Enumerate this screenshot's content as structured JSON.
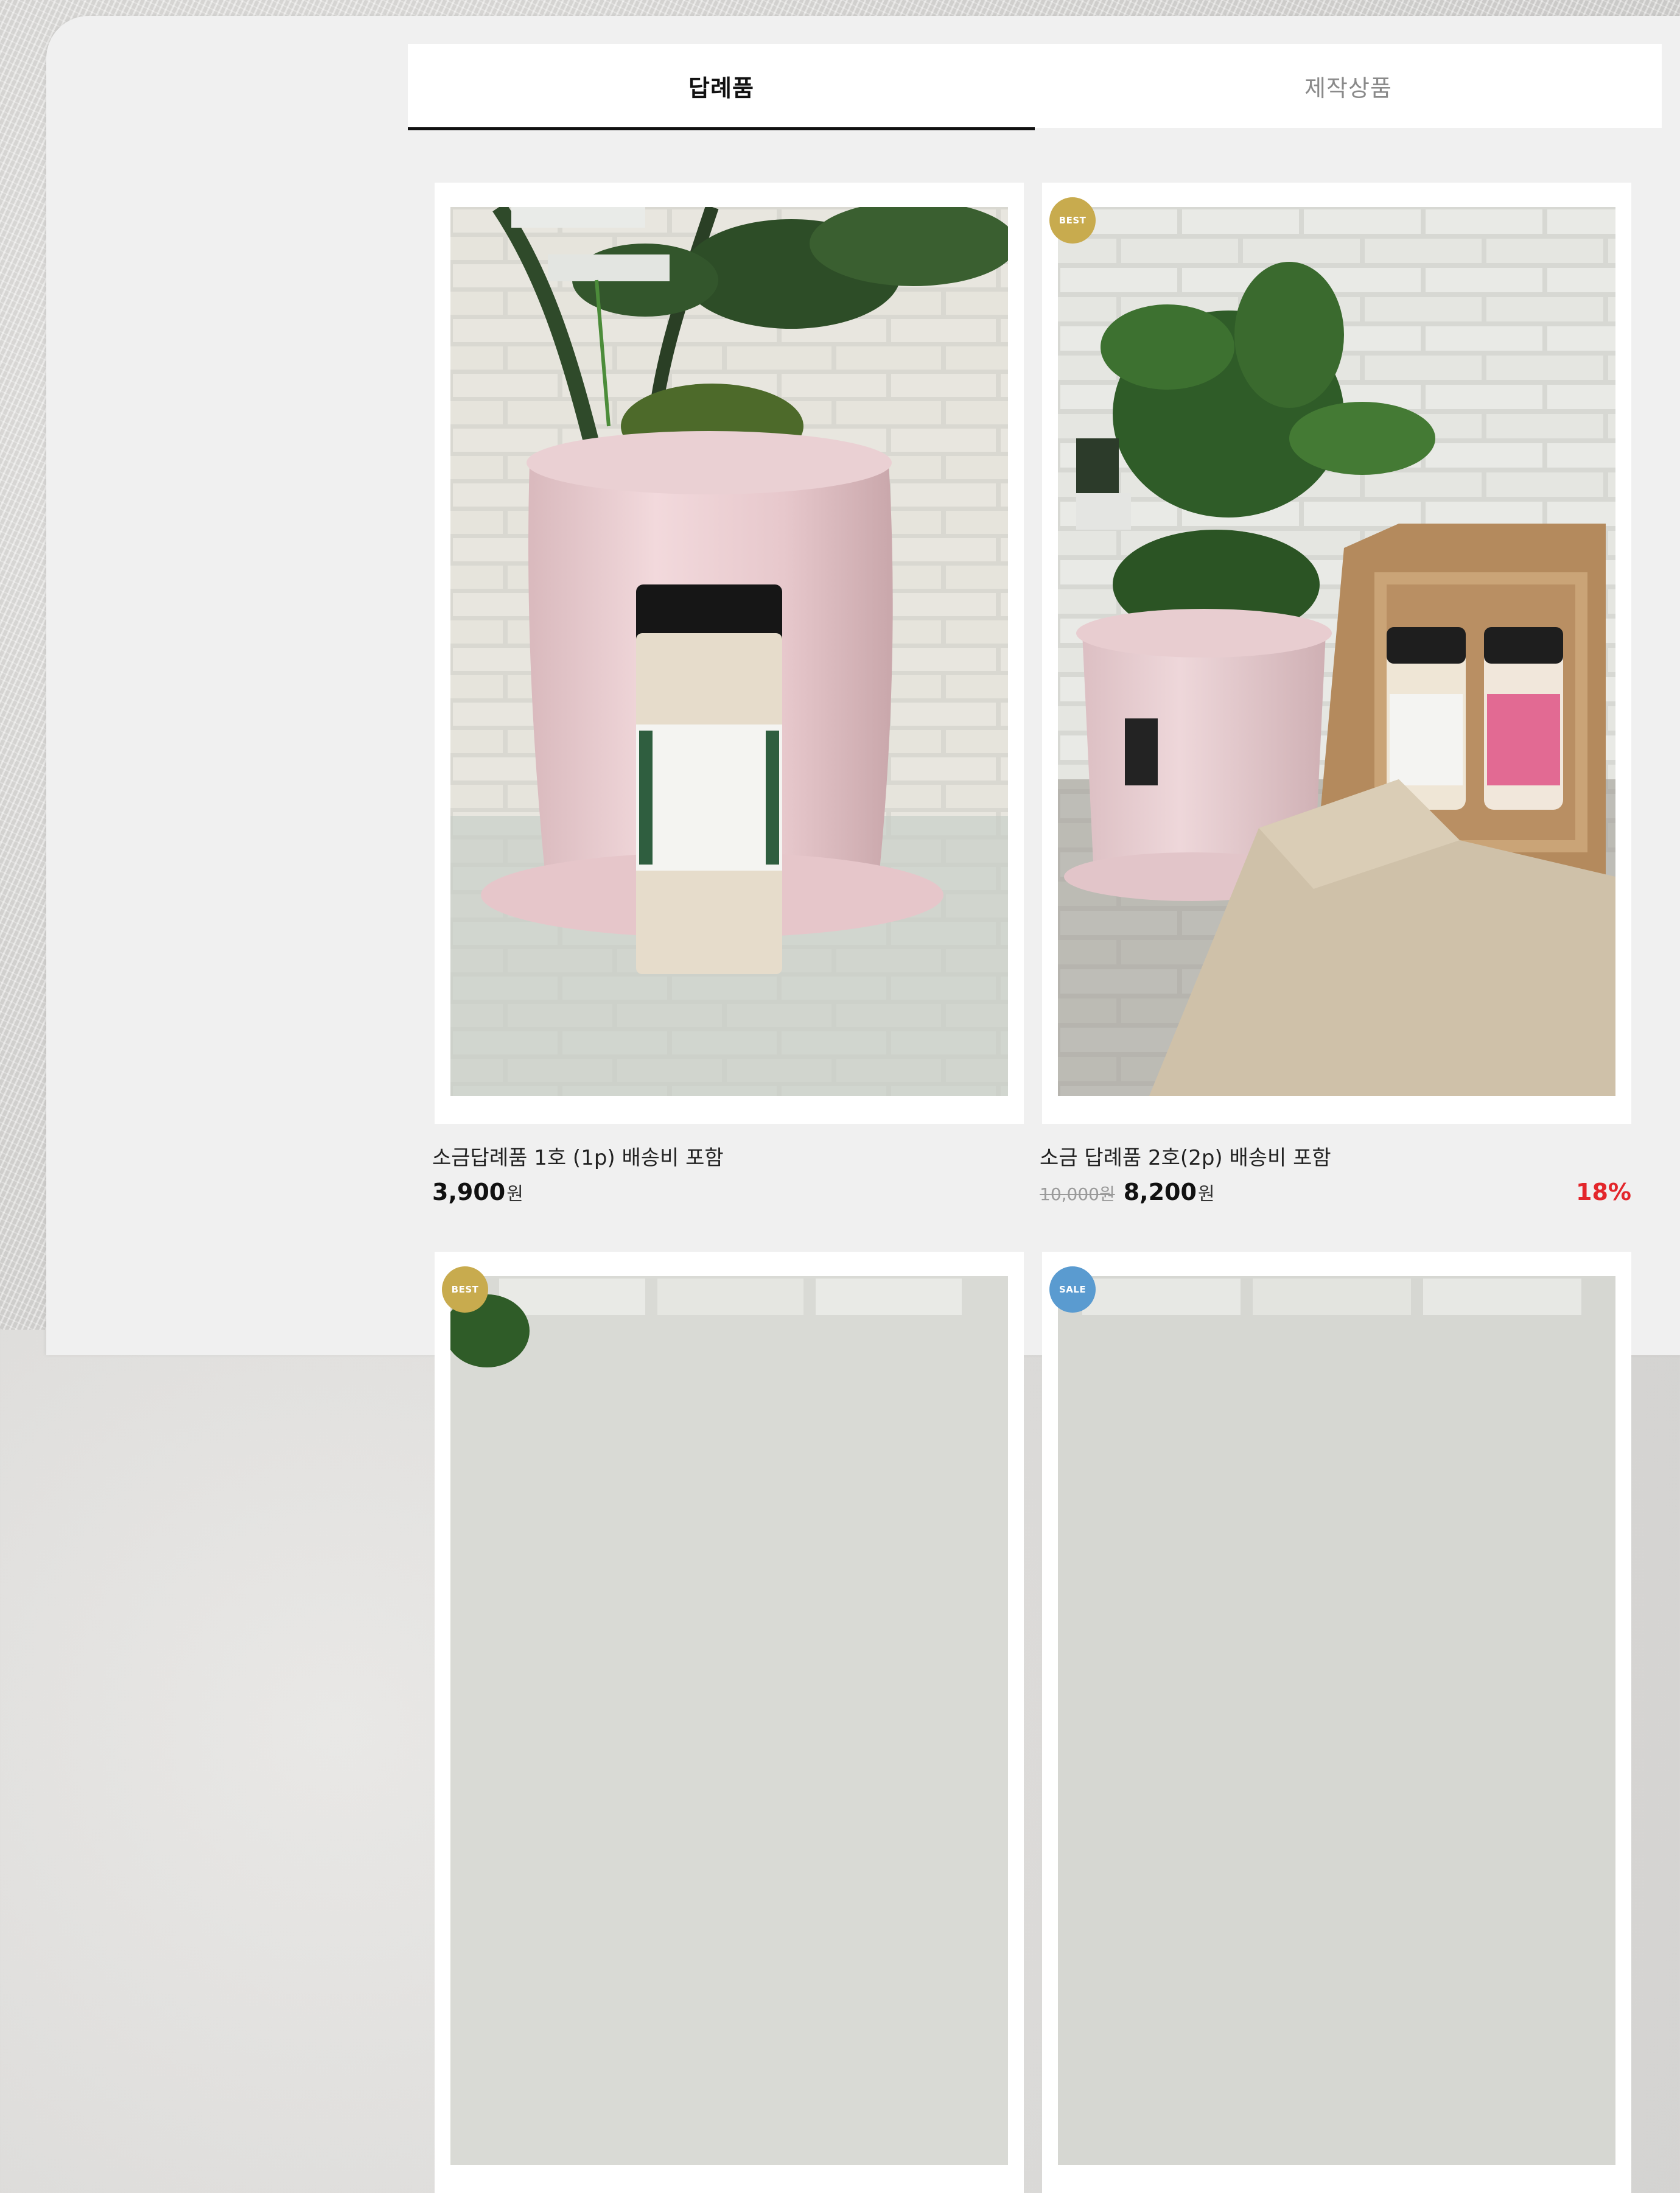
{
  "tabs": [
    {
      "label": "답례품",
      "active": true
    },
    {
      "label": "제작상품",
      "active": false
    }
  ],
  "products": [
    {
      "name": "소금답례품 1호 (1p) 배송비 포함",
      "price": "3,900",
      "currency": "원",
      "original_price": "",
      "discount": "",
      "badge": ""
    },
    {
      "name": "소금 답례품 2호(2p) 배송비 포함",
      "price": "8,200",
      "currency": "원",
      "original_price": "10,000원",
      "discount": "18%",
      "badge": "BEST"
    },
    {
      "name": "",
      "price": "",
      "currency": "",
      "original_price": "",
      "discount": "",
      "badge": "BEST"
    },
    {
      "name": "",
      "price": "",
      "currency": "",
      "original_price": "",
      "discount": "",
      "badge": "SALE"
    }
  ],
  "colors": {
    "best_badge": "#c8ab4e",
    "sale_badge": "#5a9bd0",
    "discount": "#e3262b",
    "active_tab_underline": "#111111"
  }
}
